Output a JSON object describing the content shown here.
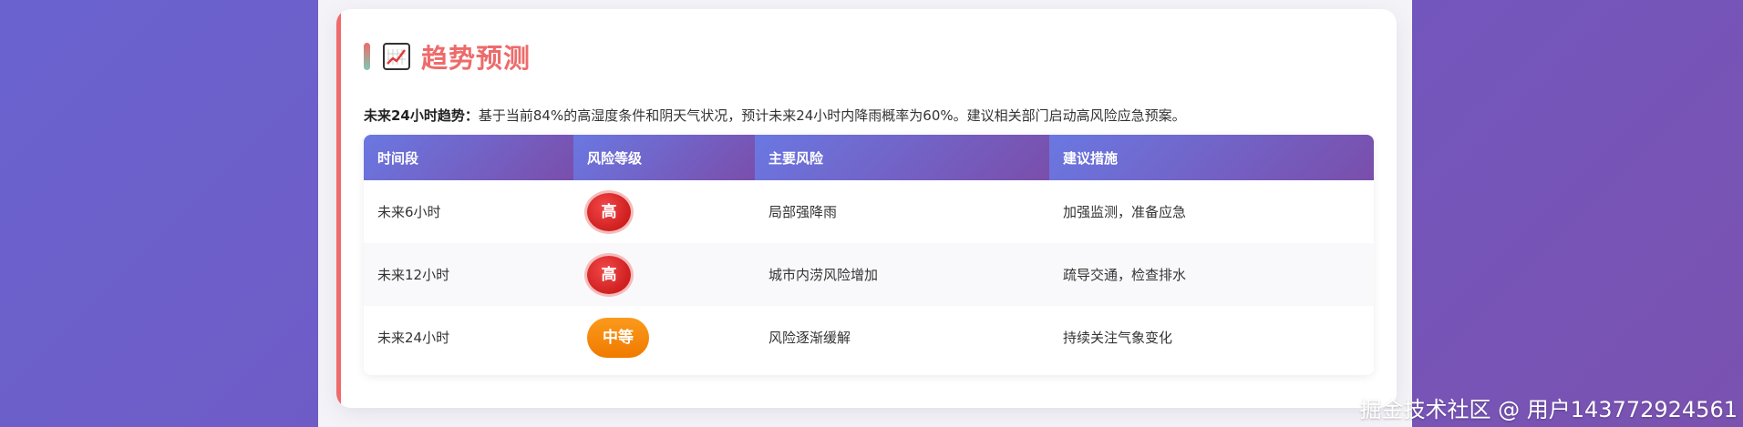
{
  "section": {
    "title": "趋势预测",
    "icon": "chart-increasing-icon"
  },
  "trend": {
    "label": "未来24小时趋势：",
    "text": "基于当前84%的高湿度条件和阴天气状况，预计未来24小时内降雨概率为60%。建议相关部门启动高风险应急预案。"
  },
  "table": {
    "headers": [
      "时间段",
      "风险等级",
      "主要风险",
      "建议措施"
    ],
    "rows": [
      {
        "period": "未来6小时",
        "level": "高",
        "risk": "局部强降雨",
        "action": "加强监测，准备应急"
      },
      {
        "period": "未来12小时",
        "level": "高",
        "risk": "城市内涝风险增加",
        "action": "疏导交通，检查排水"
      },
      {
        "period": "未来24小时",
        "level": "中等",
        "risk": "风险逐渐缓解",
        "action": "持续关注气象变化"
      }
    ]
  },
  "colors": {
    "accent": "#ee6b6b",
    "high": "#d92626",
    "medium": "#f5870c",
    "header_gradient_start": "#6a78e2",
    "header_gradient_end": "#7a4eab"
  },
  "watermark": "掘金技术社区 @ 用户143772924561"
}
